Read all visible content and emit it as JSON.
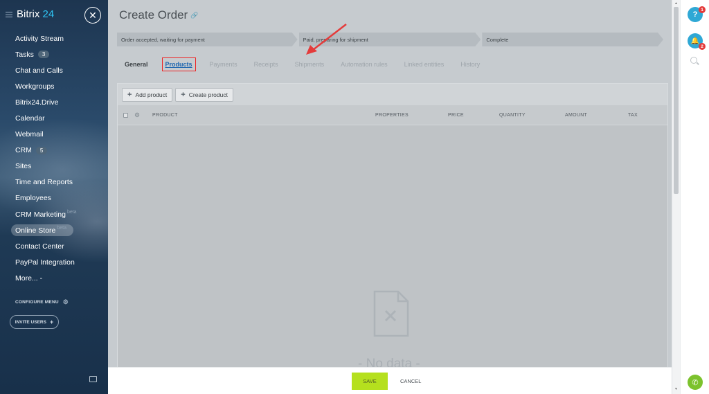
{
  "sidebar": {
    "brand_name": "Bitrix",
    "brand_number": "24",
    "items": [
      {
        "label": "Activity Stream"
      },
      {
        "label": "Tasks",
        "badge": "3"
      },
      {
        "label": "Chat and Calls"
      },
      {
        "label": "Workgroups"
      },
      {
        "label": "Bitrix24.Drive"
      },
      {
        "label": "Calendar"
      },
      {
        "label": "Webmail"
      },
      {
        "label": "CRM",
        "badge": "5"
      },
      {
        "label": "Sites"
      },
      {
        "label": "Time and Reports"
      },
      {
        "label": "Employees"
      },
      {
        "label": "CRM Marketing",
        "beta": "beta"
      },
      {
        "label": "Online Store",
        "beta": "beta"
      },
      {
        "label": "Contact Center"
      },
      {
        "label": "PayPal Integration"
      },
      {
        "label": "More... -"
      }
    ],
    "configure_menu": "CONFIGURE MENU",
    "invite_users": "INVITE USERS"
  },
  "main": {
    "title": "Create Order",
    "stages": [
      "Order accepted, waiting for payment",
      "Paid, preparing for shipment",
      "Complete"
    ],
    "tabs": [
      "General",
      "Products",
      "Payments",
      "Receipts",
      "Shipments",
      "Automation rules",
      "Linked entities",
      "History"
    ],
    "active_tab": "Products",
    "buttons": {
      "add_product": "Add product",
      "create_product": "Create product"
    },
    "columns": [
      "PRODUCT",
      "PROPERTIES",
      "PRICE",
      "QUANTITY",
      "AMOUNT",
      "TAX"
    ],
    "empty_text": "- No data -"
  },
  "footer": {
    "save": "SAVE",
    "cancel": "CANCEL"
  },
  "rightbar": {
    "help_badge": "1",
    "bell_badge": "2"
  },
  "colors": {
    "accent": "#2fc6f6",
    "save": "#b5e01e",
    "highlight": "#e22222",
    "tab_active": "#2067b0"
  }
}
